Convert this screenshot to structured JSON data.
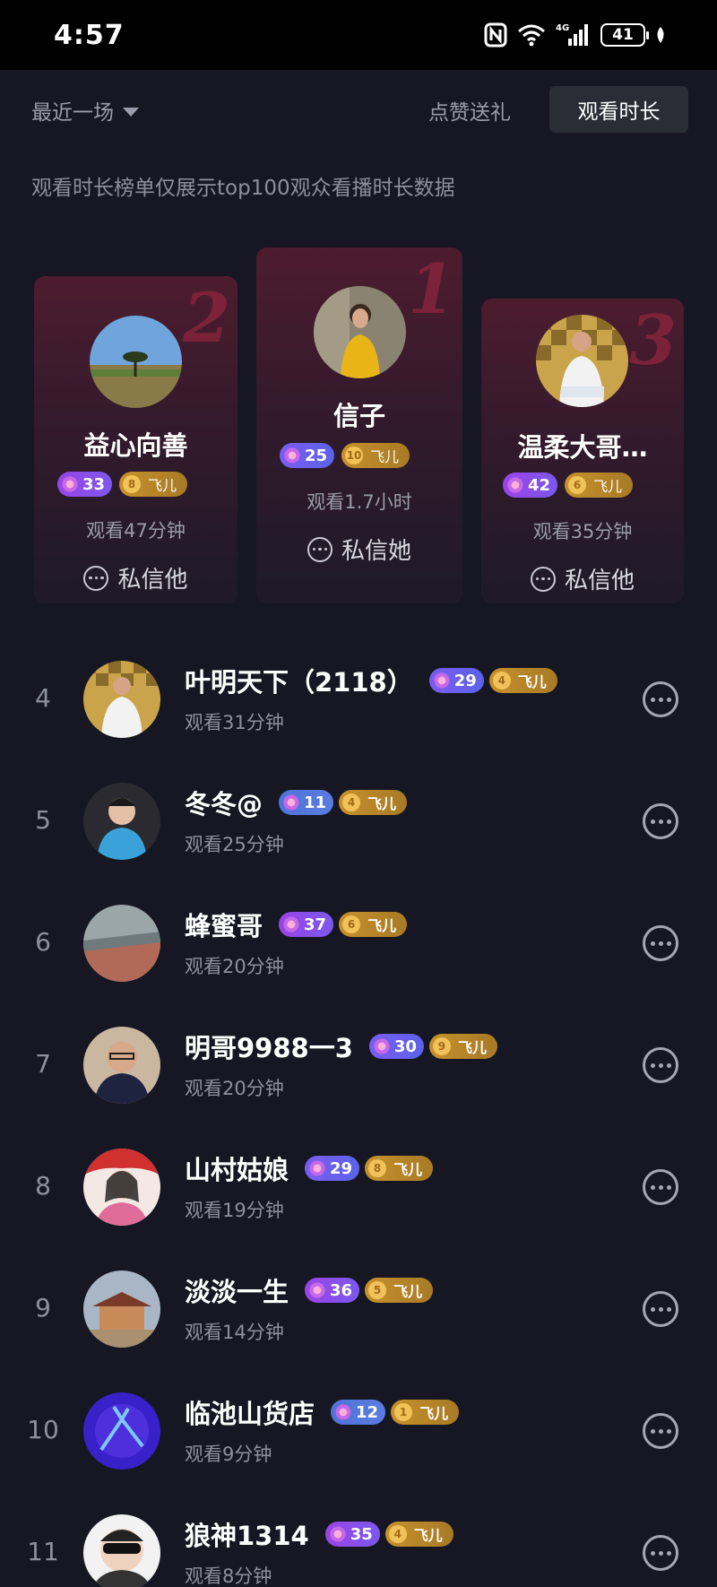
{
  "status_bar": {
    "time": "4:57",
    "battery": "41",
    "network": "4G"
  },
  "filter": {
    "range_label": "最近一场",
    "tab_gifts": "点赞送礼",
    "tab_watch": "观看时长"
  },
  "notice": "观看时长榜单仅展示top100观众看播时长数据",
  "podium": [
    {
      "rank": "2",
      "name": "益心向善",
      "level": "33",
      "fan_level": "8",
      "fan_label": "飞儿",
      "watch": "观看47分钟",
      "dm": "私信他"
    },
    {
      "rank": "1",
      "name": "信子",
      "level": "25",
      "fan_level": "10",
      "fan_label": "飞儿",
      "watch": "观看1.7小时",
      "dm": "私信她"
    },
    {
      "rank": "3",
      "name": "温柔大哥…",
      "level": "42",
      "fan_level": "6",
      "fan_label": "飞儿",
      "watch": "观看35分钟",
      "dm": "私信他"
    }
  ],
  "list": [
    {
      "rank": "4",
      "name": "叶明天下（2118）",
      "level": "29",
      "fan_level": "4",
      "fan_label": "飞儿",
      "watch": "观看31分钟"
    },
    {
      "rank": "5",
      "name": "冬冬@",
      "level": "11",
      "fan_level": "4",
      "fan_label": "飞儿",
      "watch": "观看25分钟"
    },
    {
      "rank": "6",
      "name": "蜂蜜哥",
      "level": "37",
      "fan_level": "6",
      "fan_label": "飞儿",
      "watch": "观看20分钟"
    },
    {
      "rank": "7",
      "name": "明哥9988一3",
      "level": "30",
      "fan_level": "9",
      "fan_label": "飞儿",
      "watch": "观看20分钟"
    },
    {
      "rank": "8",
      "name": "山村姑娘",
      "level": "29",
      "fan_level": "8",
      "fan_label": "飞儿",
      "watch": "观看19分钟"
    },
    {
      "rank": "9",
      "name": "淡淡一生",
      "level": "36",
      "fan_level": "5",
      "fan_label": "飞儿",
      "watch": "观看14分钟"
    },
    {
      "rank": "10",
      "name": "临池山货店",
      "level": "12",
      "fan_level": "1",
      "fan_label": "飞儿",
      "watch": "观看9分钟"
    },
    {
      "rank": "11",
      "name": "狼神1314",
      "level": "35",
      "fan_level": "4",
      "fan_label": "飞儿",
      "watch": "观看8分钟"
    }
  ]
}
